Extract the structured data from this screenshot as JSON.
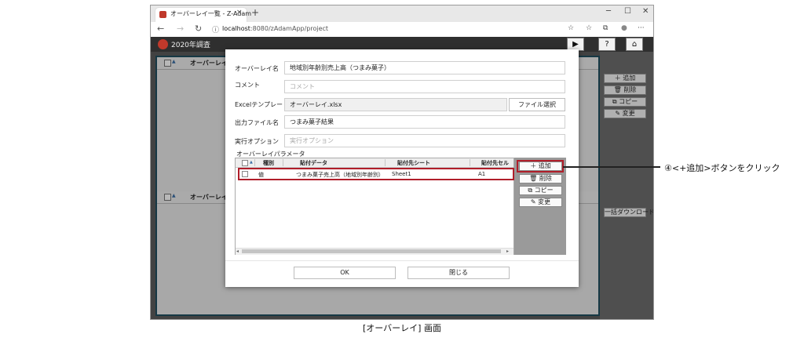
{
  "browser": {
    "tab_title": "オーバーレイ一覧 - Z-Adam",
    "tab_close": "×",
    "new_tab": "+",
    "window_controls": {
      "minimize": "─",
      "maximize": "☐",
      "close": "✕"
    },
    "nav": {
      "back": "←",
      "forward": "→",
      "refresh": "↻",
      "info": "ⓘ"
    },
    "url_host": "localhost",
    "url_rest": ":8080/zAdamApp/project",
    "toolbar_icons": {
      "star": "☆",
      "favorites": "☆",
      "collections": "⧉",
      "profile": "●",
      "more": "···"
    }
  },
  "app": {
    "title": "2020年調査",
    "header_buttons": {
      "run": "▶",
      "help": "?",
      "home": "⌂"
    },
    "panels": [
      {
        "header_label": "オーバーレイ名"
      },
      {
        "header_label": "オーバーレイ名"
      }
    ],
    "side_buttons": [
      "＋ 追加",
      "🗑 削除",
      "⧉ コピー",
      "✎ 変更"
    ],
    "bulk_download": "一括ダウンロード"
  },
  "dialog": {
    "fields": {
      "overlay_name": {
        "label": "オーバーレイ名",
        "value": "地域別年齢別売上高（つまみ菓子）"
      },
      "comment": {
        "label": "コメント",
        "placeholder": "コメント"
      },
      "excel_template": {
        "label": "Excelテンプレート",
        "value": "オーバーレイ.xlsx",
        "button": "ファイル選択"
      },
      "output_file": {
        "label": "出力ファイル名",
        "value": "つまみ菓子結果"
      },
      "exec_option": {
        "label": "実行オプション",
        "placeholder": "実行オプション"
      }
    },
    "params": {
      "label": "オーバーレイパラメータ",
      "headers": {
        "sort": "▲",
        "kind": "種別",
        "data": "貼付データ",
        "sheet": "貼付先シート",
        "cell": "貼付先セル"
      },
      "rows": [
        {
          "kind": "値",
          "data": "つまみ菓子売上高（地域別年齢別）",
          "sheet": "Sheet1",
          "cell": "A1"
        }
      ],
      "scroll_left": "◂",
      "scroll_right": "▸",
      "buttons": {
        "add": "＋ 追加",
        "delete": "🗑 削除",
        "copy": "⧉ コピー",
        "edit": "✎ 変更"
      }
    },
    "ok": "OK",
    "close": "閉じる"
  },
  "annotation": {
    "callout": "④<+追加>ボタンをクリック"
  },
  "caption": "[オーバーレイ] 画面",
  "colors": {
    "highlight": "#b01e2a",
    "panel_border": "#1f4e5f",
    "header_bg": "#2f2f2f"
  }
}
